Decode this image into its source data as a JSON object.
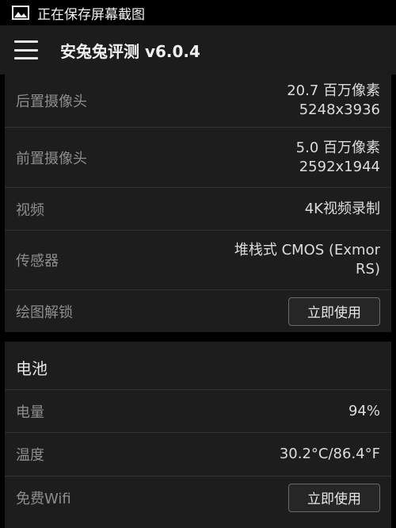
{
  "status_bar": {
    "icon": "image-icon",
    "text": "正在保存屏幕截图"
  },
  "app_bar": {
    "menu_icon": "hamburger-menu-icon",
    "title": "安兔兔评测 v6.0.4"
  },
  "camera_section": {
    "rows": [
      {
        "label": "后置摄像头",
        "value_lines": [
          "20.7 百万像素",
          "5248x3936"
        ]
      },
      {
        "label": "前置摄像头",
        "value_lines": [
          "5.0 百万像素",
          "2592x1944"
        ]
      },
      {
        "label": "视频",
        "value_lines": [
          "4K视频录制"
        ]
      },
      {
        "label": "传感器",
        "value_lines": [
          "堆栈式 CMOS (Exmor",
          "RS)"
        ]
      },
      {
        "label": "绘图解锁",
        "button": "立即使用"
      }
    ]
  },
  "battery_section": {
    "title": "电池",
    "rows": [
      {
        "label": "电量",
        "value_lines": [
          "94%"
        ]
      },
      {
        "label": "温度",
        "value_lines": [
          "30.2°C/86.4°F"
        ]
      },
      {
        "label": "免费Wifi",
        "button": "立即使用"
      }
    ]
  },
  "colors": {
    "background": "#000000",
    "card": "#1d1d1d",
    "app_bar": "#1c1c1c",
    "label": "#8e8e8e",
    "value": "#dcdcdc"
  }
}
